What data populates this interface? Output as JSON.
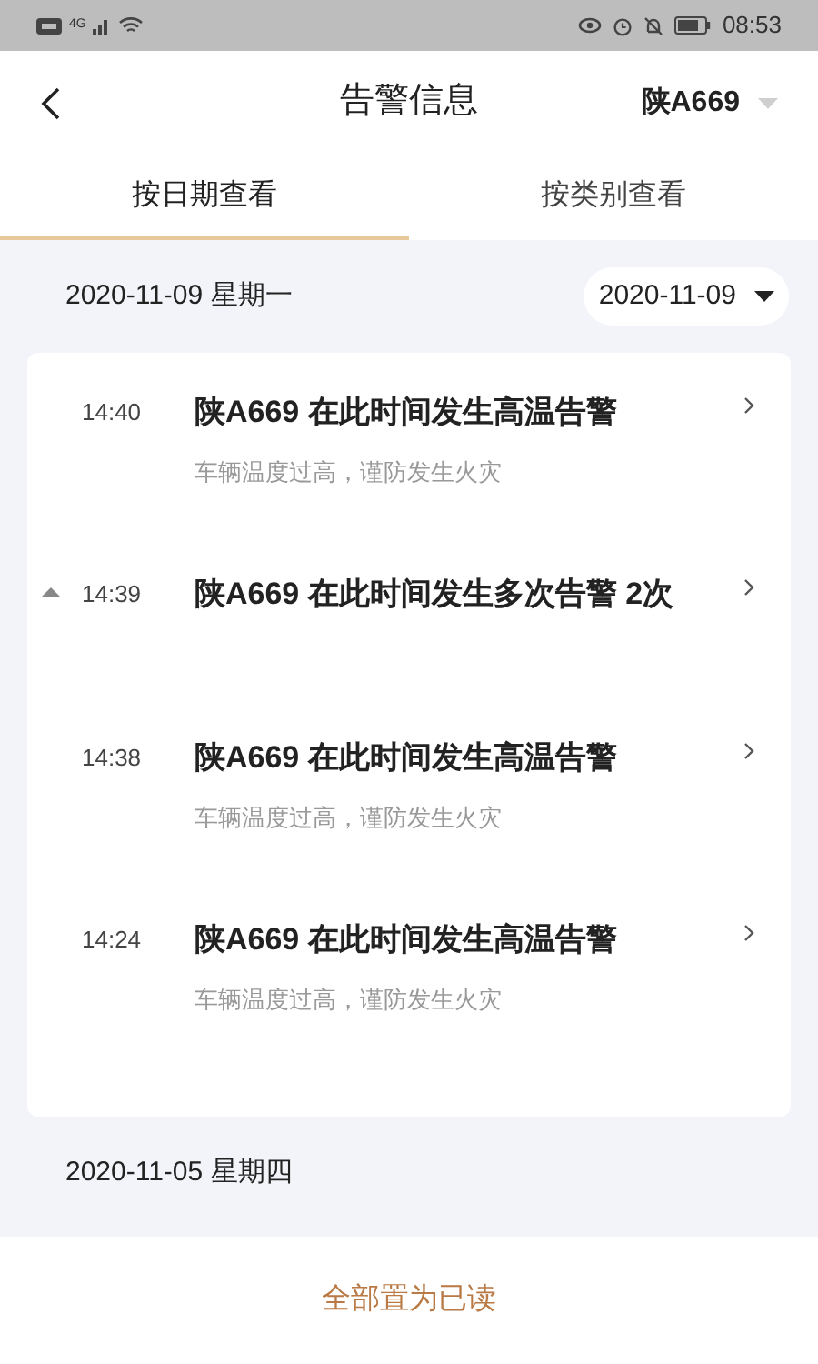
{
  "status_bar": {
    "time": "08:53",
    "network": "4G"
  },
  "header": {
    "title": "告警信息",
    "vehicle": "陕A669"
  },
  "tabs": [
    {
      "label": "按日期查看",
      "selected": true
    },
    {
      "label": "按类别查看",
      "selected": false
    }
  ],
  "groups": [
    {
      "date": "2020-11-09 星期一",
      "picker": "2020-11-09",
      "alerts": [
        {
          "time": "14:40",
          "title": "陕A669 在此时间发生高温告警",
          "detail": "车辆温度过高，谨防发生火灾",
          "expanded": false
        },
        {
          "time": "14:39",
          "title": "陕A669 在此时间发生多次告警 2次",
          "expanded": true
        },
        {
          "time": "14:38",
          "title": "陕A669 在此时间发生高温告警",
          "detail": "车辆温度过高，谨防发生火灾",
          "expanded": false
        },
        {
          "time": "14:24",
          "title": "陕A669 在此时间发生高温告警",
          "detail": "车辆温度过高，谨防发生火灾",
          "expanded": false
        }
      ]
    },
    {
      "date": "2020-11-05 星期四"
    }
  ],
  "footer": {
    "action": "全部置为已读"
  }
}
